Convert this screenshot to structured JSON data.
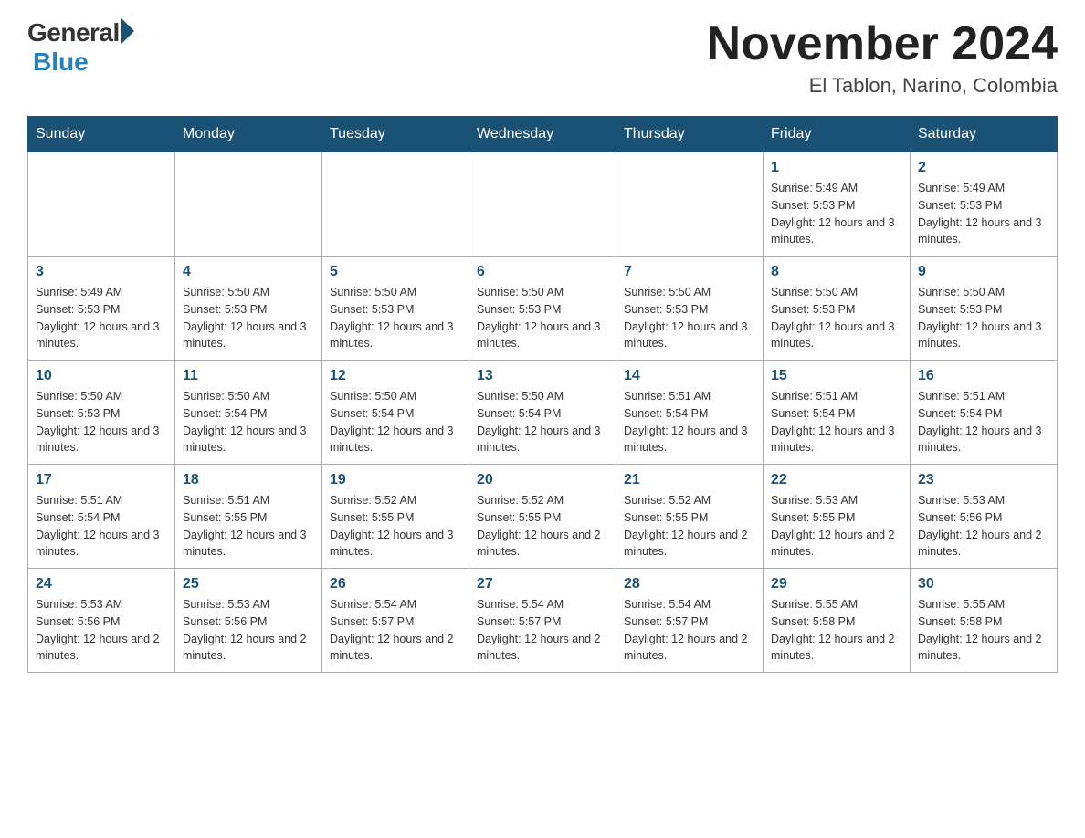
{
  "header": {
    "logo": {
      "general": "General",
      "blue": "Blue",
      "tagline": "Blue"
    },
    "title": "November 2024",
    "location": "El Tablon, Narino, Colombia"
  },
  "days_of_week": [
    "Sunday",
    "Monday",
    "Tuesday",
    "Wednesday",
    "Thursday",
    "Friday",
    "Saturday"
  ],
  "weeks": [
    [
      {
        "day": "",
        "sunrise": "",
        "sunset": "",
        "daylight": ""
      },
      {
        "day": "",
        "sunrise": "",
        "sunset": "",
        "daylight": ""
      },
      {
        "day": "",
        "sunrise": "",
        "sunset": "",
        "daylight": ""
      },
      {
        "day": "",
        "sunrise": "",
        "sunset": "",
        "daylight": ""
      },
      {
        "day": "",
        "sunrise": "",
        "sunset": "",
        "daylight": ""
      },
      {
        "day": "1",
        "sunrise": "Sunrise: 5:49 AM",
        "sunset": "Sunset: 5:53 PM",
        "daylight": "Daylight: 12 hours and 3 minutes."
      },
      {
        "day": "2",
        "sunrise": "Sunrise: 5:49 AM",
        "sunset": "Sunset: 5:53 PM",
        "daylight": "Daylight: 12 hours and 3 minutes."
      }
    ],
    [
      {
        "day": "3",
        "sunrise": "Sunrise: 5:49 AM",
        "sunset": "Sunset: 5:53 PM",
        "daylight": "Daylight: 12 hours and 3 minutes."
      },
      {
        "day": "4",
        "sunrise": "Sunrise: 5:50 AM",
        "sunset": "Sunset: 5:53 PM",
        "daylight": "Daylight: 12 hours and 3 minutes."
      },
      {
        "day": "5",
        "sunrise": "Sunrise: 5:50 AM",
        "sunset": "Sunset: 5:53 PM",
        "daylight": "Daylight: 12 hours and 3 minutes."
      },
      {
        "day": "6",
        "sunrise": "Sunrise: 5:50 AM",
        "sunset": "Sunset: 5:53 PM",
        "daylight": "Daylight: 12 hours and 3 minutes."
      },
      {
        "day": "7",
        "sunrise": "Sunrise: 5:50 AM",
        "sunset": "Sunset: 5:53 PM",
        "daylight": "Daylight: 12 hours and 3 minutes."
      },
      {
        "day": "8",
        "sunrise": "Sunrise: 5:50 AM",
        "sunset": "Sunset: 5:53 PM",
        "daylight": "Daylight: 12 hours and 3 minutes."
      },
      {
        "day": "9",
        "sunrise": "Sunrise: 5:50 AM",
        "sunset": "Sunset: 5:53 PM",
        "daylight": "Daylight: 12 hours and 3 minutes."
      }
    ],
    [
      {
        "day": "10",
        "sunrise": "Sunrise: 5:50 AM",
        "sunset": "Sunset: 5:53 PM",
        "daylight": "Daylight: 12 hours and 3 minutes."
      },
      {
        "day": "11",
        "sunrise": "Sunrise: 5:50 AM",
        "sunset": "Sunset: 5:54 PM",
        "daylight": "Daylight: 12 hours and 3 minutes."
      },
      {
        "day": "12",
        "sunrise": "Sunrise: 5:50 AM",
        "sunset": "Sunset: 5:54 PM",
        "daylight": "Daylight: 12 hours and 3 minutes."
      },
      {
        "day": "13",
        "sunrise": "Sunrise: 5:50 AM",
        "sunset": "Sunset: 5:54 PM",
        "daylight": "Daylight: 12 hours and 3 minutes."
      },
      {
        "day": "14",
        "sunrise": "Sunrise: 5:51 AM",
        "sunset": "Sunset: 5:54 PM",
        "daylight": "Daylight: 12 hours and 3 minutes."
      },
      {
        "day": "15",
        "sunrise": "Sunrise: 5:51 AM",
        "sunset": "Sunset: 5:54 PM",
        "daylight": "Daylight: 12 hours and 3 minutes."
      },
      {
        "day": "16",
        "sunrise": "Sunrise: 5:51 AM",
        "sunset": "Sunset: 5:54 PM",
        "daylight": "Daylight: 12 hours and 3 minutes."
      }
    ],
    [
      {
        "day": "17",
        "sunrise": "Sunrise: 5:51 AM",
        "sunset": "Sunset: 5:54 PM",
        "daylight": "Daylight: 12 hours and 3 minutes."
      },
      {
        "day": "18",
        "sunrise": "Sunrise: 5:51 AM",
        "sunset": "Sunset: 5:55 PM",
        "daylight": "Daylight: 12 hours and 3 minutes."
      },
      {
        "day": "19",
        "sunrise": "Sunrise: 5:52 AM",
        "sunset": "Sunset: 5:55 PM",
        "daylight": "Daylight: 12 hours and 3 minutes."
      },
      {
        "day": "20",
        "sunrise": "Sunrise: 5:52 AM",
        "sunset": "Sunset: 5:55 PM",
        "daylight": "Daylight: 12 hours and 2 minutes."
      },
      {
        "day": "21",
        "sunrise": "Sunrise: 5:52 AM",
        "sunset": "Sunset: 5:55 PM",
        "daylight": "Daylight: 12 hours and 2 minutes."
      },
      {
        "day": "22",
        "sunrise": "Sunrise: 5:53 AM",
        "sunset": "Sunset: 5:55 PM",
        "daylight": "Daylight: 12 hours and 2 minutes."
      },
      {
        "day": "23",
        "sunrise": "Sunrise: 5:53 AM",
        "sunset": "Sunset: 5:56 PM",
        "daylight": "Daylight: 12 hours and 2 minutes."
      }
    ],
    [
      {
        "day": "24",
        "sunrise": "Sunrise: 5:53 AM",
        "sunset": "Sunset: 5:56 PM",
        "daylight": "Daylight: 12 hours and 2 minutes."
      },
      {
        "day": "25",
        "sunrise": "Sunrise: 5:53 AM",
        "sunset": "Sunset: 5:56 PM",
        "daylight": "Daylight: 12 hours and 2 minutes."
      },
      {
        "day": "26",
        "sunrise": "Sunrise: 5:54 AM",
        "sunset": "Sunset: 5:57 PM",
        "daylight": "Daylight: 12 hours and 2 minutes."
      },
      {
        "day": "27",
        "sunrise": "Sunrise: 5:54 AM",
        "sunset": "Sunset: 5:57 PM",
        "daylight": "Daylight: 12 hours and 2 minutes."
      },
      {
        "day": "28",
        "sunrise": "Sunrise: 5:54 AM",
        "sunset": "Sunset: 5:57 PM",
        "daylight": "Daylight: 12 hours and 2 minutes."
      },
      {
        "day": "29",
        "sunrise": "Sunrise: 5:55 AM",
        "sunset": "Sunset: 5:58 PM",
        "daylight": "Daylight: 12 hours and 2 minutes."
      },
      {
        "day": "30",
        "sunrise": "Sunrise: 5:55 AM",
        "sunset": "Sunset: 5:58 PM",
        "daylight": "Daylight: 12 hours and 2 minutes."
      }
    ]
  ]
}
